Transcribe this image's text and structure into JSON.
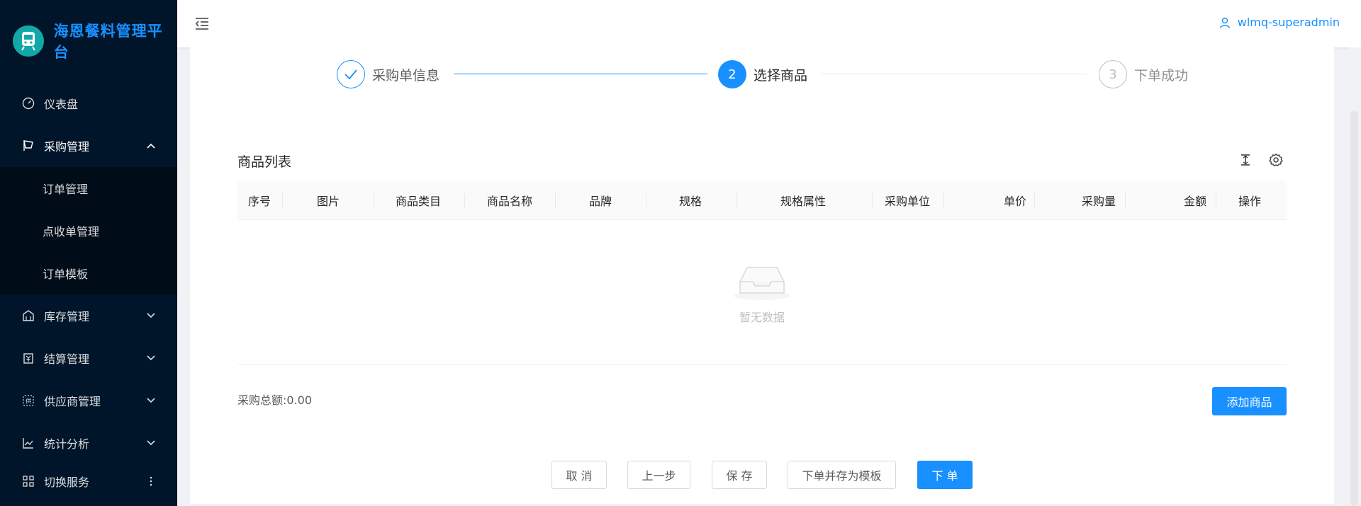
{
  "app": {
    "title": "海恩餐料管理平台"
  },
  "sidebar": {
    "items": [
      {
        "label": "仪表盘"
      },
      {
        "label": "采购管理"
      },
      {
        "label": "库存管理"
      },
      {
        "label": "结算管理"
      },
      {
        "label": "供应商管理"
      },
      {
        "label": "统计分析"
      },
      {
        "label": "切换服务"
      }
    ],
    "submenu": [
      {
        "label": "订单管理"
      },
      {
        "label": "点收单管理"
      },
      {
        "label": "订单模板"
      }
    ]
  },
  "header": {
    "username": "wlmq-superadmin"
  },
  "steps": [
    {
      "number": "1",
      "title": "采购单信息",
      "status": "finished"
    },
    {
      "number": "2",
      "title": "选择商品",
      "status": "current"
    },
    {
      "number": "3",
      "title": "下单成功",
      "status": "waiting"
    }
  ],
  "table": {
    "title": "商品列表",
    "columns": [
      "序号",
      "图片",
      "商品类目",
      "商品名称",
      "品牌",
      "规格",
      "规格属性",
      "采购单位",
      "单价",
      "采购量",
      "金额",
      "操作"
    ],
    "empty_text": "暂无数据"
  },
  "summary": {
    "total_label": "采购总额:0.00"
  },
  "buttons": {
    "add_product": "添加商品",
    "cancel": "取 消",
    "prev": "上一步",
    "save": "保 存",
    "save_template": "下单并存为模板",
    "order": "下 单"
  },
  "colors": {
    "primary": "#1890ff",
    "sidebar_bg": "#001529"
  }
}
